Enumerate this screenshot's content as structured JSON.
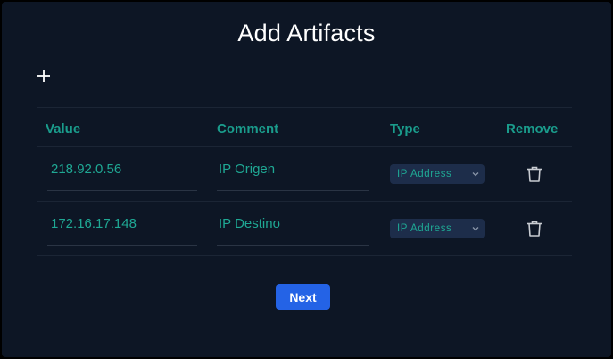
{
  "dialog": {
    "title": "Add Artifacts",
    "add_icon": "plus-icon"
  },
  "table": {
    "headers": {
      "value": "Value",
      "comment": "Comment",
      "type": "Type",
      "remove": "Remove"
    },
    "rows": [
      {
        "value": "218.92.0.56",
        "comment": "IP Origen",
        "type": "IP Address",
        "remove_icon": "trash-icon"
      },
      {
        "value": "172.16.17.148",
        "comment": "IP Destino",
        "type": "IP Address",
        "remove_icon": "trash-icon"
      }
    ]
  },
  "footer": {
    "next_label": "Next"
  },
  "colors": {
    "background": "#0d1625",
    "accent_text": "#1fa894",
    "header_text": "#1a9c8c",
    "button": "#2463e6",
    "select_bg": "#1d2d4a"
  }
}
